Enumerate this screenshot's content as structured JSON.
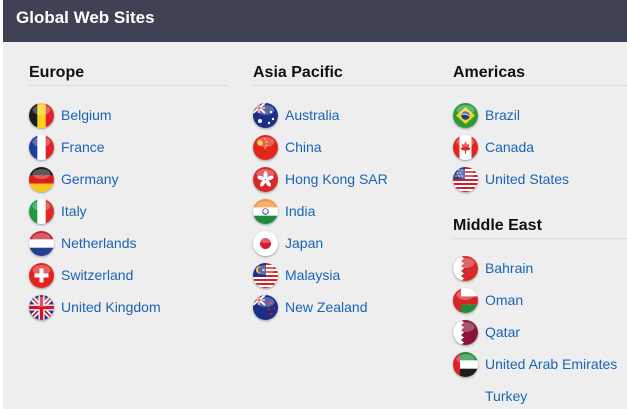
{
  "header": {
    "title": "Global Web Sites"
  },
  "colors": {
    "header_bg": "#3f4254",
    "panel_bg": "#eeeeee",
    "link": "#1a64b4"
  },
  "regions": [
    {
      "id": "europe",
      "title": "Europe",
      "countries": [
        {
          "name": "Belgium",
          "flag": "belgium-flag-icon"
        },
        {
          "name": "France",
          "flag": "france-flag-icon"
        },
        {
          "name": "Germany",
          "flag": "germany-flag-icon"
        },
        {
          "name": "Italy",
          "flag": "italy-flag-icon"
        },
        {
          "name": "Netherlands",
          "flag": "netherlands-flag-icon"
        },
        {
          "name": "Switzerland",
          "flag": "switzerland-flag-icon"
        },
        {
          "name": "United Kingdom",
          "flag": "united-kingdom-flag-icon"
        }
      ]
    },
    {
      "id": "asia-pacific",
      "title": "Asia Pacific",
      "countries": [
        {
          "name": "Australia",
          "flag": "australia-flag-icon"
        },
        {
          "name": "China",
          "flag": "china-flag-icon"
        },
        {
          "name": "Hong Kong SAR",
          "flag": "hong-kong-flag-icon"
        },
        {
          "name": "India",
          "flag": "india-flag-icon"
        },
        {
          "name": "Japan",
          "flag": "japan-flag-icon"
        },
        {
          "name": "Malaysia",
          "flag": "malaysia-flag-icon"
        },
        {
          "name": "New Zealand",
          "flag": "new-zealand-flag-icon"
        }
      ]
    },
    {
      "id": "americas",
      "title": "Americas",
      "countries": [
        {
          "name": "Brazil",
          "flag": "brazil-flag-icon"
        },
        {
          "name": "Canada",
          "flag": "canada-flag-icon"
        },
        {
          "name": "United States",
          "flag": "united-states-flag-icon"
        }
      ]
    },
    {
      "id": "middle-east",
      "title": "Middle East",
      "countries": [
        {
          "name": "Bahrain",
          "flag": "bahrain-flag-icon"
        },
        {
          "name": "Oman",
          "flag": "oman-flag-icon"
        },
        {
          "name": "Qatar",
          "flag": "qatar-flag-icon"
        },
        {
          "name": "United Arab Emirates",
          "flag": "uae-flag-icon"
        },
        {
          "name": "Turkey",
          "flag": ""
        }
      ]
    }
  ]
}
